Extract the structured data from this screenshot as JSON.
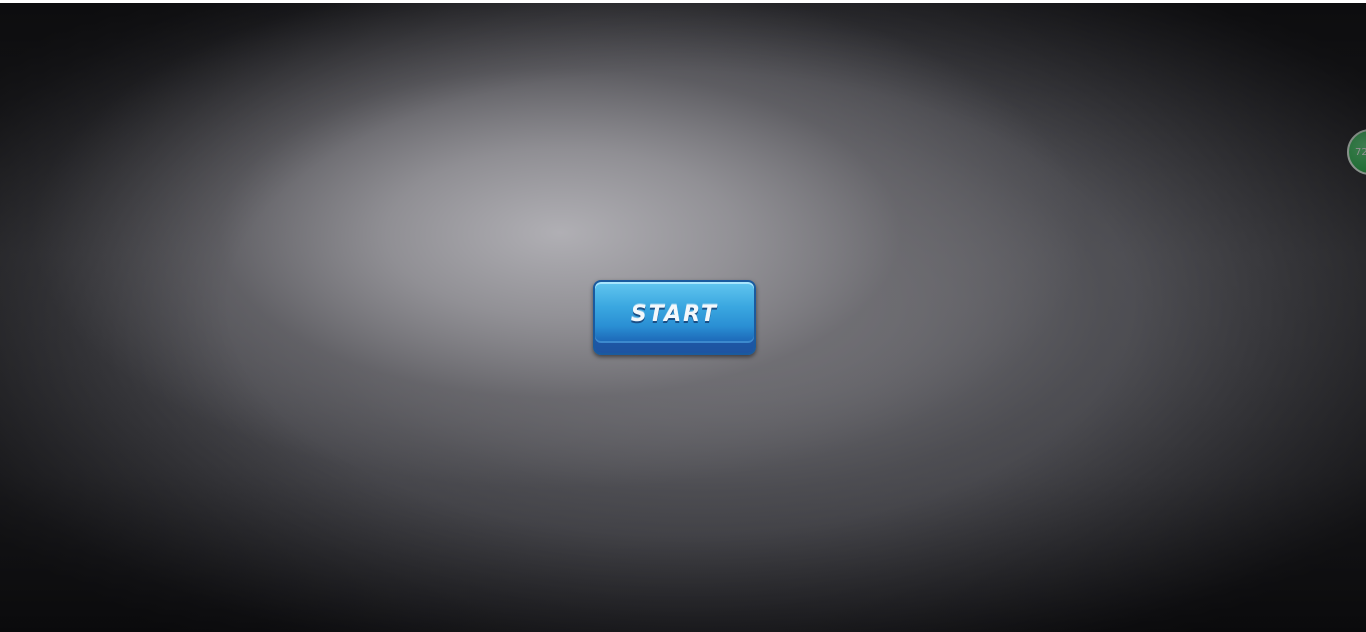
{
  "game": {
    "start_label": "START",
    "badge_text": "72"
  },
  "colors": {
    "button_primary": "#2a8fd4",
    "button_border": "#1a5a9e",
    "badge": "#3fbf61",
    "background": "#3a3a3f"
  }
}
